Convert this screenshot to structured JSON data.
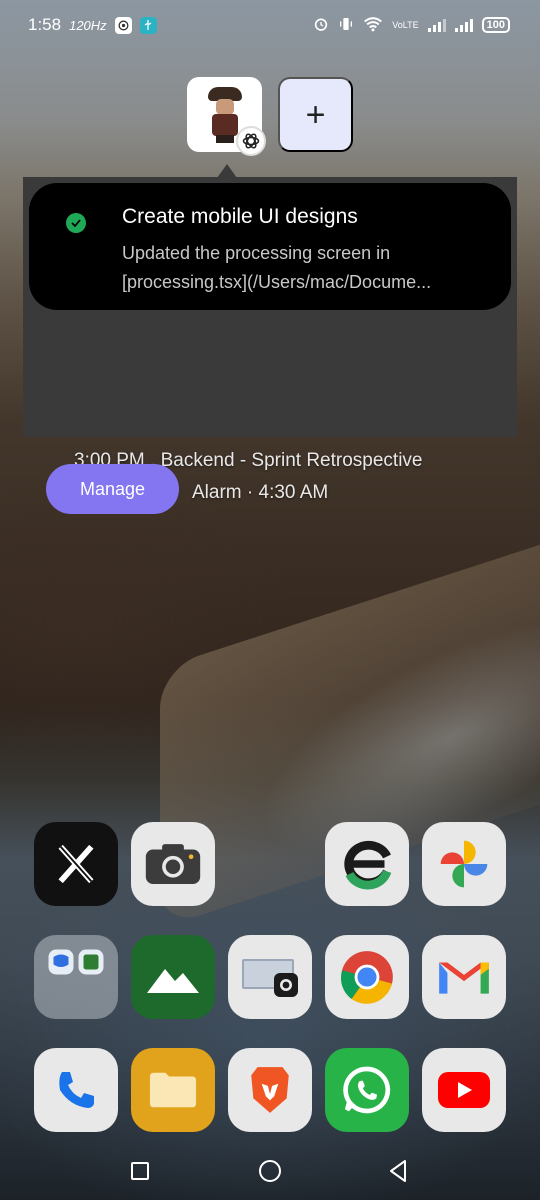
{
  "status_bar": {
    "time": "1:58",
    "refresh_rate": "120Hz",
    "network_label": "VoLTE",
    "battery": "100"
  },
  "header": {
    "add_label": "+"
  },
  "notification": {
    "title": "Create mobile UI designs",
    "body_line1": "Updated the processing screen in",
    "body_line2": "[processing.tsx](/Users/mac/Docume..."
  },
  "widget": {
    "event": "3:00 PM . Backend - Sprint Retrospective",
    "alarm": "Alarm · 4:30 AM",
    "manage_label": "Manage"
  },
  "apps": {
    "row1": [
      "x-icon",
      "camera-icon",
      "expensify-icon",
      "google-photos-icon"
    ],
    "row2": [
      "folder-icon",
      "mountain-app-icon",
      "screen-mirror-icon",
      "chrome-icon",
      "gmail-icon"
    ],
    "row3": [
      "phone-icon",
      "files-icon",
      "brave-icon",
      "whatsapp-icon",
      "youtube-icon"
    ]
  },
  "colors": {
    "accent": "#8376f0",
    "success": "#1fa855",
    "panel": "#3a3a3a"
  }
}
